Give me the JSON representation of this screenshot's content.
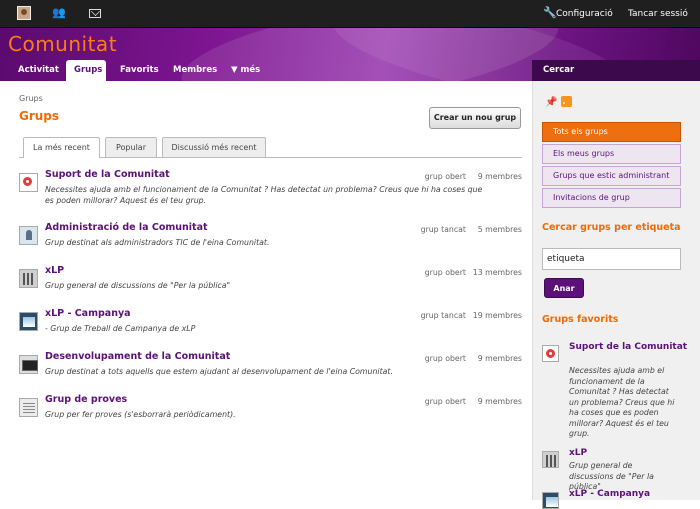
{
  "topbar": {
    "avatar_icon": "avatar-icon",
    "people_icon": "people-icon",
    "mail_icon": "mail-icon",
    "settings_icon": "wrench-icon",
    "settings_label": "Configuració",
    "logout_label": "Tancar sessió"
  },
  "header": {
    "site_title": "Comunitat"
  },
  "nav": {
    "items": [
      {
        "label": "Activitat"
      },
      {
        "label": "Grups"
      },
      {
        "label": "Favorits"
      },
      {
        "label": "Membres"
      },
      {
        "label": "▼ més"
      }
    ],
    "search_label": "Cercar"
  },
  "main": {
    "breadcrumb": "Grups",
    "title": "Grups",
    "create_button": "Crear un nou grup",
    "tabs": [
      {
        "label": "La més recent"
      },
      {
        "label": "Popular"
      },
      {
        "label": "Discussió més recent"
      }
    ],
    "groups": [
      {
        "name": "Suport de la Comunitat",
        "description": "Necessites ajuda amb el funcionament de la Comunitat ? Has detectat un problema? Creus que hi ha coses que es poden millorar? Aquest és el teu grup.",
        "status": "grup obert",
        "members": "9 membres",
        "icon": "lifebuoy-icon"
      },
      {
        "name": "Administració de la Comunitat",
        "description": "Grup destinat als administradors TIC de l'eina Comunitat.",
        "status": "grup tancat",
        "members": "5 membres",
        "icon": "admin-person-icon"
      },
      {
        "name": "xLP",
        "description": "Grup general de discussions de \"Per la pública\"",
        "status": "grup obert",
        "members": "13 membres",
        "icon": "building-icon"
      },
      {
        "name": "xLP - Campanya",
        "description": "- Grup de Treball de Campanya de xLP",
        "status": "grup tancat",
        "members": "19 membres",
        "icon": "photo-icon"
      },
      {
        "name": "Desenvolupament de la Comunitat",
        "description": "Grup destinat a tots aquells que estem ajudant al desenvolupament de l'eina Comunitat.",
        "status": "grup obert",
        "members": "9 membres",
        "icon": "screen-icon"
      },
      {
        "name": "Grup de proves",
        "description": "Grup per fer proves (s'esborrarà periòdicament).",
        "status": "grup obert",
        "members": "9 membres",
        "icon": "test-icon"
      }
    ]
  },
  "sidebar": {
    "pin_icon": "pin-icon",
    "rss_icon": "rss-icon",
    "buttons": [
      {
        "label": "Tots els grups"
      },
      {
        "label": "Els meus grups"
      },
      {
        "label": "Grups que estic administrant"
      },
      {
        "label": "Invitacions de grup"
      }
    ],
    "tag_title": "Cercar grups per etiqueta",
    "tag_input_value": "etiqueta",
    "search_button": "Anar",
    "favorites_title": "Grups favorits",
    "favorites": [
      {
        "name": "Suport de la Comunitat",
        "description": "Necessites ajuda amb el funcionament de la Comunitat ? Has detectat un problema? Creus que hi ha coses que es poden millorar? Aquest és el teu grup."
      },
      {
        "name": "xLP",
        "description": "Grup general de discussions de \"Per la pública\""
      },
      {
        "name": "xLP - Campanya",
        "description": ""
      }
    ]
  },
  "colors": {
    "accent_orange": "#f26a00",
    "brand_purple": "#5b1178",
    "topbar": "#1f1f1f"
  }
}
